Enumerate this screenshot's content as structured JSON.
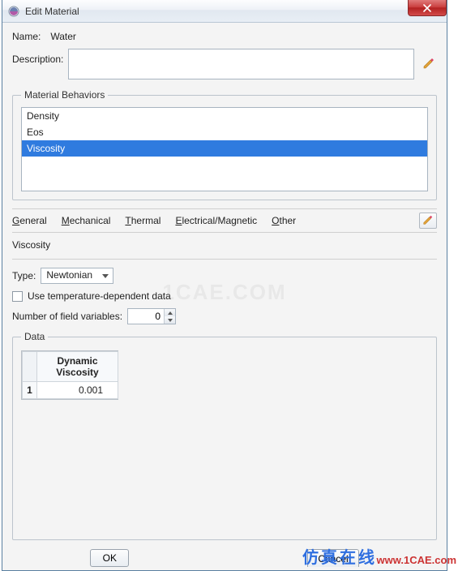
{
  "window": {
    "title": "Edit Material"
  },
  "name": {
    "label": "Name:",
    "value": "Water"
  },
  "description": {
    "label": "Description:",
    "value": ""
  },
  "behaviors": {
    "legend": "Material Behaviors",
    "items": [
      "Density",
      "Eos",
      "Viscosity"
    ],
    "selected_index": 2
  },
  "menu": {
    "general": "General",
    "mechanical": "Mechanical",
    "thermal": "Thermal",
    "electrical": "Electrical/Magnetic",
    "other": "Other"
  },
  "section": {
    "title": "Viscosity"
  },
  "type": {
    "label": "Type:",
    "value": "Newtonian"
  },
  "temp_dep": {
    "label": "Use temperature-dependent data",
    "checked": false
  },
  "field_vars": {
    "label": "Number of field variables:",
    "value": "0"
  },
  "data": {
    "legend": "Data",
    "header": "Dynamic Viscosity",
    "rows": [
      {
        "n": "1",
        "v": "0.001"
      }
    ]
  },
  "buttons": {
    "ok": "OK",
    "cancel": "Cancel"
  },
  "watermarks": {
    "cn": "仿真在线",
    "url": "www.1CAE.com",
    "center": "1CAE.COM"
  }
}
